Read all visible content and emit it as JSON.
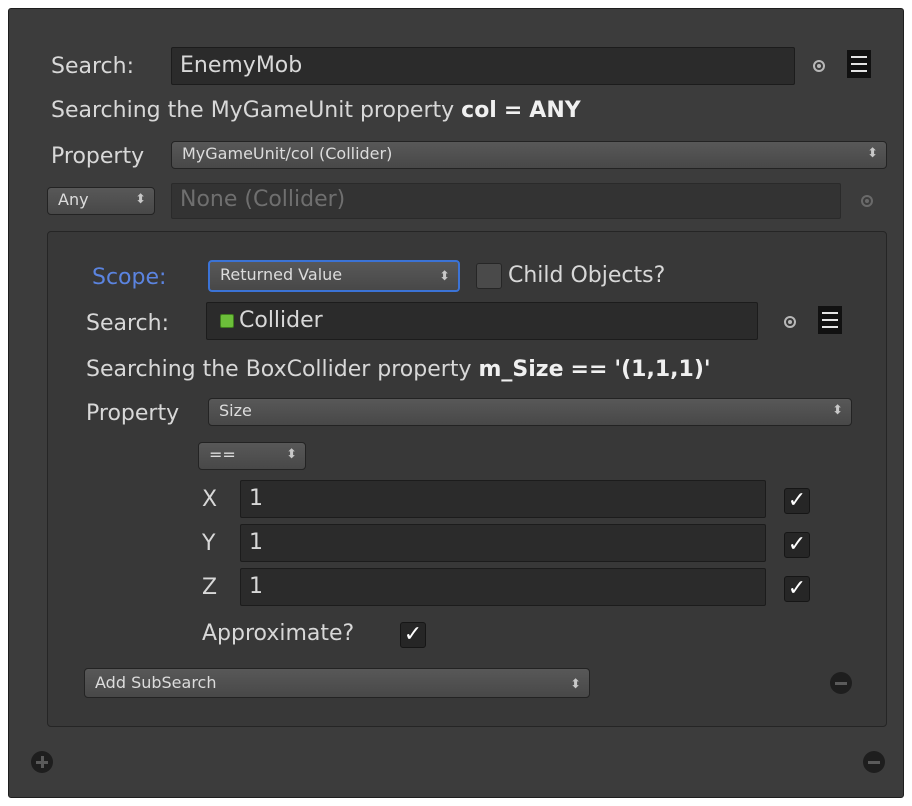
{
  "top": {
    "search_label": "Search:",
    "search_value": "EnemyMob",
    "description_prefix": "Searching the MyGameUnit property",
    "description_field": "col",
    "description_op": "=",
    "description_value": "ANY",
    "property_label": "Property",
    "property_value": "MyGameUnit/col (Collider)",
    "any_dropdown": "Any",
    "object_field_placeholder": "None (Collider)"
  },
  "sub": {
    "scope_label": "Scope:",
    "scope_value": "Returned Value",
    "child_objects_label": "Child Objects?",
    "child_objects_checked": false,
    "search_label": "Search:",
    "search_value": "Collider",
    "description_prefix": "Searching the BoxCollider property",
    "description_field": "m_Size",
    "description_op": "==",
    "description_value": "'(1,1,1)'",
    "property_label": "Property",
    "property_value": "Size",
    "comparison_value": "==",
    "vector": [
      {
        "axis": "X",
        "value": "1",
        "checked": true
      },
      {
        "axis": "Y",
        "value": "1",
        "checked": true
      },
      {
        "axis": "Z",
        "value": "1",
        "checked": true
      }
    ],
    "approximate_label": "Approximate?",
    "approximate_checked": true,
    "add_subsearch_label": "Add SubSearch"
  },
  "icons": {
    "checkmark": "✓",
    "arrows": "⬍"
  },
  "colors": {
    "panel_bg": "#3c3c3c",
    "scope_accent": "#5b84e0",
    "focus_border": "#3b73d6"
  }
}
